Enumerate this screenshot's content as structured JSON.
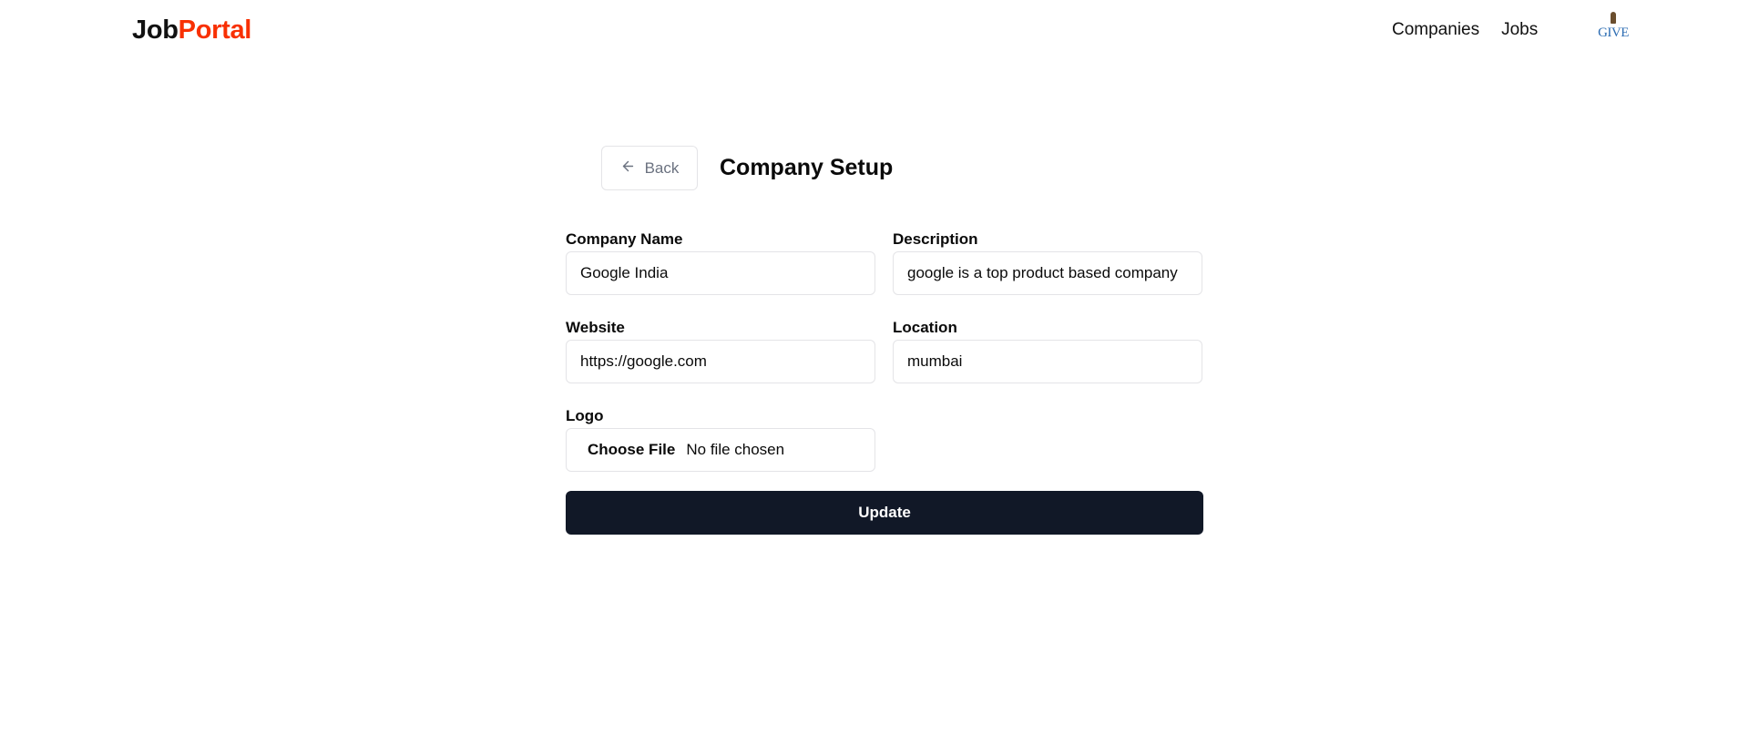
{
  "navbar": {
    "logo_job": "Job",
    "logo_portal": "Portal",
    "links": [
      "Companies",
      "Jobs"
    ],
    "avatar_text": "GIVE"
  },
  "header": {
    "back_label": "Back",
    "title": "Company Setup"
  },
  "form": {
    "company_name": {
      "label": "Company Name",
      "value": "Google India"
    },
    "description": {
      "label": "Description",
      "value": "google is a top product based company"
    },
    "website": {
      "label": "Website",
      "value": "https://google.com"
    },
    "location": {
      "label": "Location",
      "value": "mumbai"
    },
    "logo": {
      "label": "Logo",
      "button": "Choose File",
      "status": "No file chosen"
    },
    "submit_label": "Update"
  },
  "colors": {
    "brand_accent": "#f83002",
    "primary_button": "#111827",
    "border": "#e4e4e7"
  },
  "icons": {
    "back": "arrow-left-icon"
  }
}
